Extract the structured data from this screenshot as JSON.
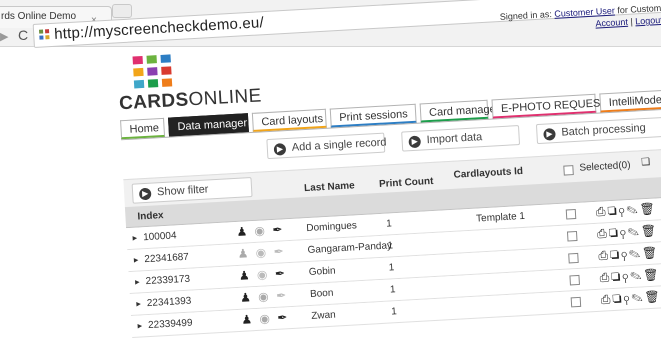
{
  "browser": {
    "tab_title": "rds Online Demo",
    "close_glyph": "×",
    "url": "http://myscreencheckdemo.eu/",
    "reload_glyph": "C"
  },
  "header": {
    "signed_in_prefix": "Signed in as:",
    "user": "Customer User",
    "for_text": "for Customer",
    "account": "Account",
    "separator": "|",
    "logout": "Logout"
  },
  "logo": {
    "bold": "CARDS",
    "light": "ONLINE",
    "colors": [
      "#e0306f",
      "#6cb33f",
      "#2d7ec4",
      "#f2a51a",
      "#8a3fb1",
      "#d93a2f",
      "#3fa7c9",
      "#1d9e4b",
      "#ef7d1a"
    ]
  },
  "tabs": [
    {
      "label": "Home",
      "accent": "#6cb33f"
    },
    {
      "label": "Data manager",
      "accent": "#222222",
      "active": true
    },
    {
      "label": "Card layouts",
      "accent": "#f2a51a"
    },
    {
      "label": "Print sessions",
      "accent": "#2d7ec4"
    },
    {
      "label": "Card manager",
      "accent": "#1d9e4b"
    },
    {
      "label": "E-PHOTO REQUEST",
      "accent": "#e0306f"
    },
    {
      "label": "IntelliMode",
      "accent": "#ef7d1a"
    }
  ],
  "actions": {
    "add_record": "Add a single record",
    "import_data": "Import data",
    "batch": "Batch processing"
  },
  "filter": {
    "show_filter": "Show filter",
    "cardlayouts_id": "Cardlayouts Id",
    "selected": "Selected(0)"
  },
  "columns": {
    "index": "Index",
    "last_name": "Last Name",
    "print_count": "Print Count"
  },
  "rows": [
    {
      "index": "100004",
      "name": "Domingues",
      "count": "1",
      "template": "Template 1"
    },
    {
      "index": "22341687",
      "name": "Gangaram-Panday",
      "count": "1",
      "template": ""
    },
    {
      "index": "22339173",
      "name": "Gobin",
      "count": "1",
      "template": ""
    },
    {
      "index": "22341393",
      "name": "Boon",
      "count": "1",
      "template": ""
    },
    {
      "index": "22339499",
      "name": "Zwan",
      "count": "1",
      "template": ""
    }
  ],
  "icons": {
    "person": "person-icon",
    "fingerprint": "fingerprint-icon",
    "signature": "pen-icon",
    "print": "print-icon",
    "copy": "copy-icon",
    "search": "search-icon",
    "edit": "edit-icon",
    "delete": "trash-icon"
  }
}
